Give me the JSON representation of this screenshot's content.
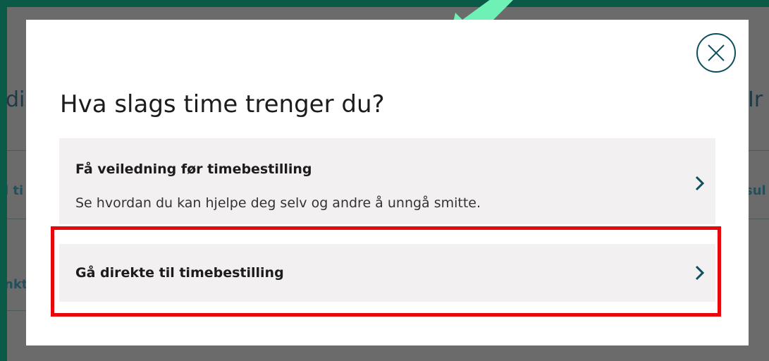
{
  "background": {
    "heading_left": "di",
    "heading_right": "Ir",
    "link_left_1": "l ti",
    "link_left_2": "nkt",
    "link_right_1": "sul"
  },
  "modal": {
    "title": "Hva slags time trenger du?",
    "close_icon": "close-icon",
    "options": [
      {
        "title": "Få veiledning før timebestilling",
        "description": "Se hvordan du kan hjelpe deg selv og andre å unngå smitte.",
        "icon": "chevron-right-icon"
      },
      {
        "title": "Gå direkte til timebestilling",
        "icon": "chevron-right-icon"
      }
    ]
  },
  "annotations": {
    "arrow_color": "#6ff0b4",
    "highlight_color": "#e8080b"
  },
  "colors": {
    "frame": "#0b5a48",
    "accent": "#0e4f5e",
    "option_bg": "#f2f0f0"
  }
}
